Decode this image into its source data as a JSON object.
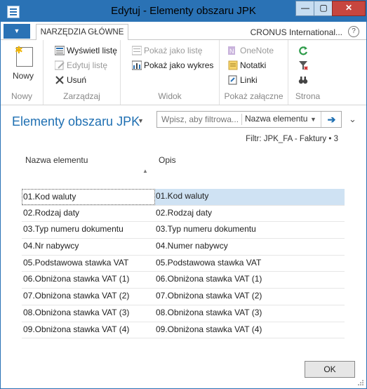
{
  "window": {
    "title": "Edytuj - Elementy obszaru JPK",
    "min_glyph": "—",
    "max_glyph": "▢",
    "close_glyph": "✕"
  },
  "tabs": {
    "app_menu_glyph": "▼",
    "active_tab": "NARZĘDZIA GŁÓWNE",
    "company": "CRONUS International...",
    "help_glyph": "?"
  },
  "ribbon": {
    "nowy": {
      "label": "Nowy",
      "group": "Nowy"
    },
    "zarzadzaj": {
      "group": "Zarządzaj",
      "wyswietl_liste": "Wyświetl listę",
      "edytuj_liste": "Edytuj listę",
      "usun": "Usuń"
    },
    "widok": {
      "group": "Widok",
      "pokaz_jako_liste": "Pokaż jako listę",
      "pokaz_jako_wykres": "Pokaż jako wykres"
    },
    "zalacznik": {
      "group": "Pokaż załączne",
      "onenote": "OneNote",
      "notatki": "Notatki",
      "linki": "Linki"
    },
    "strona": {
      "group": "Strona"
    }
  },
  "header": {
    "page_title": "Elementy obszaru JPK",
    "search_placeholder": "Wpisz, aby filtrowa...",
    "field_selected": "Nazwa elementu",
    "filter": "Filtr: JPK_FA - Faktury • 3"
  },
  "columns": {
    "col1": "Nazwa elementu",
    "col2": "Opis"
  },
  "rows": [
    {
      "name": "01.Kod waluty",
      "desc": "01.Kod waluty"
    },
    {
      "name": "02.Rodzaj daty",
      "desc": "02.Rodzaj daty"
    },
    {
      "name": "03.Typ numeru dokumentu",
      "desc": "03.Typ numeru dokumentu"
    },
    {
      "name": "04.Nr nabywcy",
      "desc": "04.Numer nabywcy"
    },
    {
      "name": "05.Podstawowa stawka VAT",
      "desc": "05.Podstawowa stawka VAT"
    },
    {
      "name": "06.Obniżona stawka VAT (1)",
      "desc": "06.Obniżona stawka VAT (1)"
    },
    {
      "name": "07.Obniżona stawka VAT (2)",
      "desc": "07.Obniżona stawka VAT (2)"
    },
    {
      "name": "08.Obniżona stawka VAT (3)",
      "desc": "08.Obniżona stawka VAT (3)"
    },
    {
      "name": "09.Obniżona stawka VAT (4)",
      "desc": "09.Obniżona stawka VAT (4)"
    }
  ],
  "footer": {
    "ok": "OK"
  }
}
